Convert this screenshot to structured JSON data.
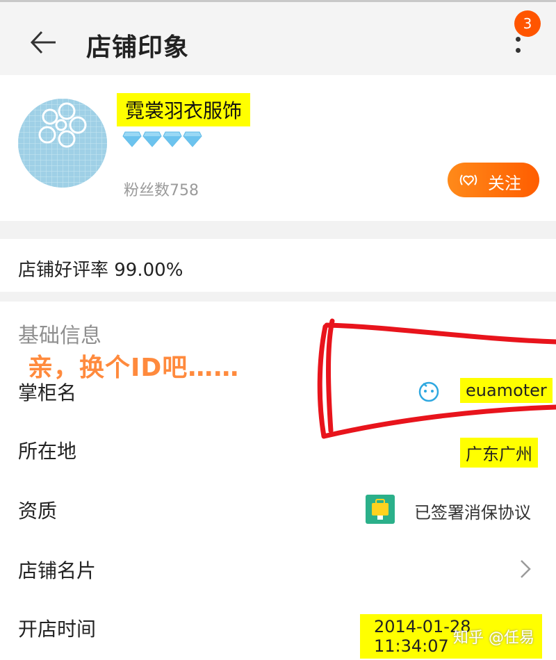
{
  "header": {
    "title": "店铺印象",
    "badge_count": "3",
    "back_icon": "arrow-left-icon",
    "more_icon": "more-vertical-icon"
  },
  "shop": {
    "name": "霓裳羽衣服饰",
    "diamond_count": 4,
    "fans_label": "粉丝数758",
    "follow_label": "关注"
  },
  "rating": {
    "text": "店铺好评率 99.00%"
  },
  "basic_info": {
    "section_title": "基础信息",
    "annotation": "亲，换个ID吧……",
    "rows": [
      {
        "label": "掌柜名",
        "value": "euamoter",
        "icon": "chat-face-icon"
      },
      {
        "label": "所在地",
        "value": "广东广州"
      },
      {
        "label": "资质",
        "value": "已签署消保协议",
        "icon": "consumer-protection-icon"
      },
      {
        "label": "店铺名片",
        "icon": "chevron-right-icon"
      },
      {
        "label": "开店时间",
        "value": "2014-01-28 11:34:07"
      }
    ]
  },
  "watermark": "知乎 @任易",
  "colors": {
    "accent": "#ff5500",
    "highlight": "#ffff00",
    "annotation_red": "#e8141c",
    "annotation_orange": "#ff8a3d"
  }
}
